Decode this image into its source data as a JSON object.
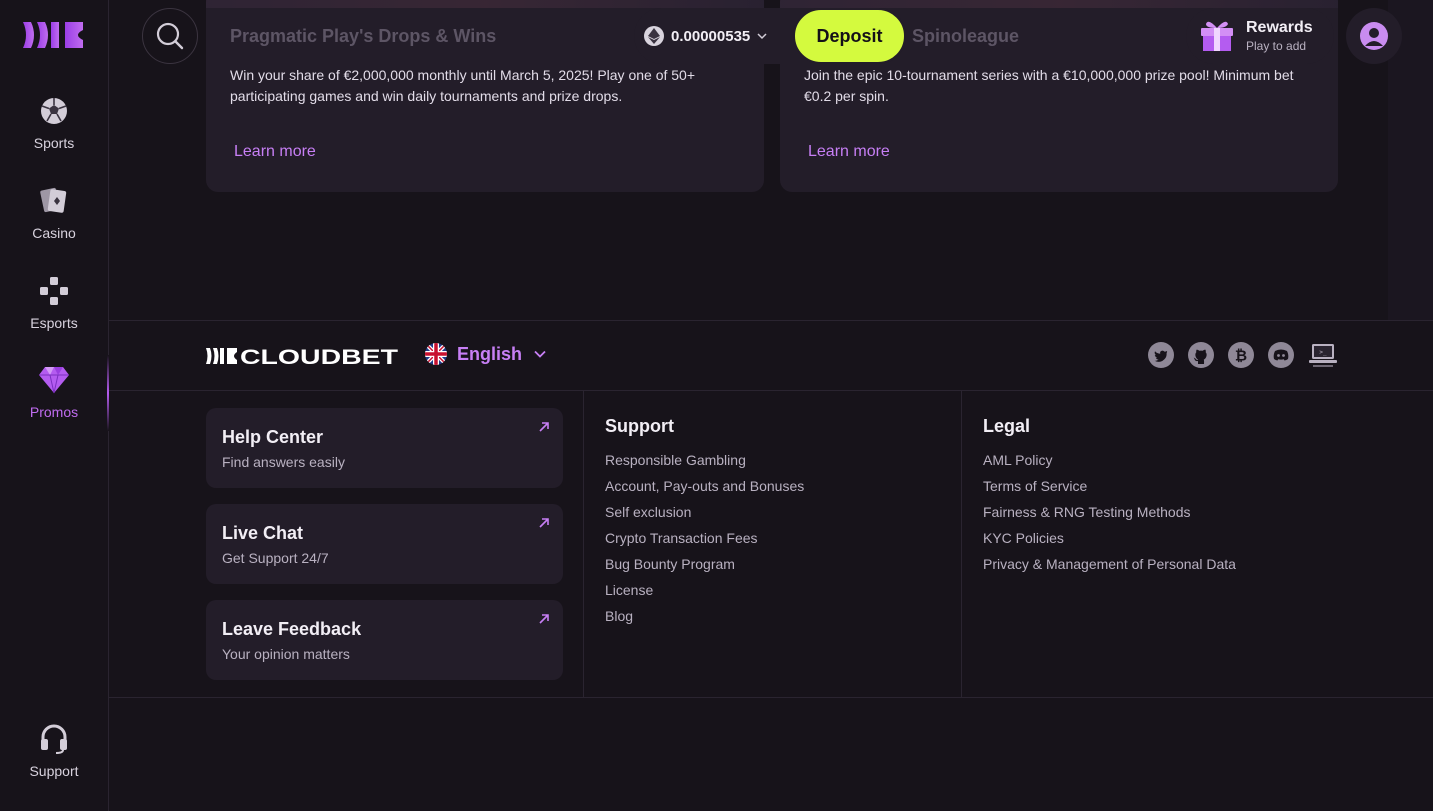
{
  "sidebar": {
    "items": [
      {
        "label": "Sports",
        "icon": "soccer-ball-icon"
      },
      {
        "label": "Casino",
        "icon": "playing-cards-icon"
      },
      {
        "label": "Esports",
        "icon": "gamepad-icon"
      },
      {
        "label": "Promos",
        "icon": "diamond-icon",
        "active": true
      }
    ],
    "support_label": "Support"
  },
  "header": {
    "balance": "0.00000535",
    "currency_icon": "ethereum-icon",
    "deposit_label": "Deposit",
    "rewards_title": "Rewards",
    "rewards_subtitle": "Play to add"
  },
  "promos": [
    {
      "title": "Pragmatic Play's Drops & Wins",
      "description": "Win your share of €2,000,000 monthly until March 5, 2025! Play one of 50+ participating games and win daily tournaments and prize drops.",
      "link": "Learn more"
    },
    {
      "title": "Spinoleague",
      "description": "Join the epic 10-tournament series with a €10,000,000 prize pool! Minimum bet €0.2 per spin.",
      "link": "Learn more"
    }
  ],
  "footer": {
    "brand": "CLOUDBET",
    "language": "English",
    "help_cards": [
      {
        "title": "Help Center",
        "subtitle": "Find answers easily"
      },
      {
        "title": "Live Chat",
        "subtitle": "Get Support 24/7"
      },
      {
        "title": "Leave Feedback",
        "subtitle": "Your opinion matters"
      }
    ],
    "support": {
      "heading": "Support",
      "links": [
        "Responsible Gambling",
        "Account, Pay-outs and Bonuses",
        "Self exclusion",
        "Crypto Transaction Fees",
        "Bug Bounty Program",
        "License",
        "Blog"
      ]
    },
    "legal": {
      "heading": "Legal",
      "links": [
        "AML Policy",
        "Terms of Service",
        "Fairness & RNG Testing Methods",
        "KYC Policies",
        "Privacy & Management of Personal Data"
      ]
    },
    "socials": [
      "twitter-icon",
      "github-icon",
      "bitcoin-icon",
      "discord-icon",
      "laptop-icon"
    ]
  },
  "colors": {
    "accent": "#c77ff5",
    "deposit": "#d4fa3e",
    "background": "#17131a",
    "card": "#231d29"
  }
}
